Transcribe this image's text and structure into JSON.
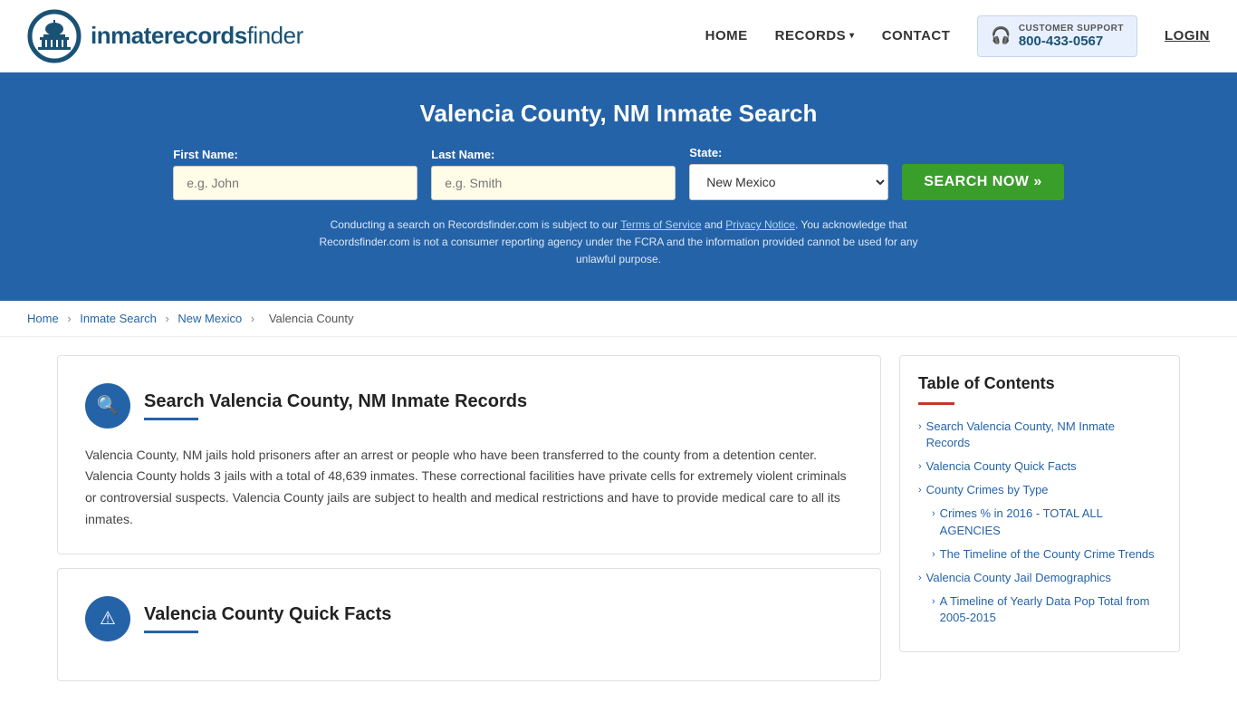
{
  "header": {
    "logo_text_regular": "inmaterecords",
    "logo_text_bold": "finder",
    "nav": {
      "home_label": "HOME",
      "records_label": "RECORDS",
      "contact_label": "CONTACT",
      "support_label": "CUSTOMER SUPPORT",
      "support_number": "800-433-0567",
      "login_label": "LOGIN"
    }
  },
  "hero": {
    "title": "Valencia County, NM Inmate Search",
    "first_name_label": "First Name:",
    "first_name_placeholder": "e.g. John",
    "last_name_label": "Last Name:",
    "last_name_placeholder": "e.g. Smith",
    "state_label": "State:",
    "state_value": "New Mexico",
    "search_button": "SEARCH NOW »",
    "disclaimer": "Conducting a search on Recordsfinder.com is subject to our Terms of Service and Privacy Notice. You acknowledge that Recordsfinder.com is not a consumer reporting agency under the FCRA and the information provided cannot be used for any unlawful purpose.",
    "terms_label": "Terms of Service",
    "privacy_label": "Privacy Notice"
  },
  "breadcrumb": {
    "home": "Home",
    "inmate_search": "Inmate Search",
    "new_mexico": "New Mexico",
    "current": "Valencia County"
  },
  "main": {
    "section1": {
      "title": "Search Valencia County, NM Inmate Records",
      "icon": "🔍",
      "body": "Valencia County, NM jails hold prisoners after an arrest or people who have been transferred to the county from a detention center. Valencia County holds 3 jails with a total of 48,639 inmates. These correctional facilities have private cells for extremely violent criminals or controversial suspects. Valencia County jails are subject to health and medical restrictions and have to provide medical care to all its inmates."
    },
    "section2": {
      "title": "Valencia County Quick Facts",
      "icon": "⚠"
    }
  },
  "toc": {
    "title": "Table of Contents",
    "items": [
      {
        "label": "Search Valencia County, NM Inmate Records",
        "sub": false
      },
      {
        "label": "Valencia County Quick Facts",
        "sub": false
      },
      {
        "label": "County Crimes by Type",
        "sub": false
      },
      {
        "label": "Crimes % in 2016 - TOTAL ALL AGENCIES",
        "sub": true
      },
      {
        "label": "The Timeline of the County Crime Trends",
        "sub": true
      },
      {
        "label": "Valencia County Jail Demographics",
        "sub": false
      },
      {
        "label": "A Timeline of Yearly Data Pop Total from 2005-2015",
        "sub": true
      }
    ]
  }
}
